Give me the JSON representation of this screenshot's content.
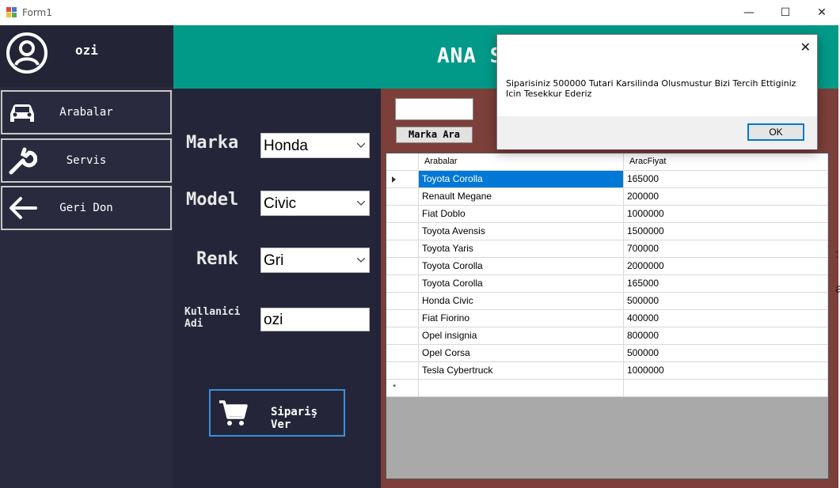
{
  "window": {
    "title": "Form1",
    "minimize": "—",
    "maximize": "☐",
    "close": "✕"
  },
  "sidebar": {
    "username": "ozi",
    "items": [
      {
        "label": "Arabalar",
        "icon": "car-icon"
      },
      {
        "label": "Servis",
        "icon": "wrench-icon"
      },
      {
        "label": "Geri Don",
        "icon": "arrow-left-icon"
      }
    ]
  },
  "header": {
    "title": "ANA S"
  },
  "form": {
    "marka_label": "Marka",
    "marka_value": "Honda",
    "model_label": "Model",
    "model_value": "Civic",
    "renk_label": "Renk",
    "renk_value": "Gri",
    "kullanici_label_1": "Kullanici",
    "kullanici_label_2": "Adi",
    "kullanici_value": "ozi",
    "order_button": "Sipariş Ver"
  },
  "search": {
    "value": "",
    "button": "Marka Ara"
  },
  "grid": {
    "columns": [
      "Arabalar",
      "AracFiyat"
    ],
    "rows": [
      [
        "Toyota Corolla",
        "165000"
      ],
      [
        "Renault Megane",
        "200000"
      ],
      [
        "Fiat Doblo",
        "1000000"
      ],
      [
        "Toyota Avensis",
        "1500000"
      ],
      [
        "Toyota Yaris",
        "700000"
      ],
      [
        "Toyota Corolla",
        "2000000"
      ],
      [
        "Toyota Corolla",
        "165000"
      ],
      [
        "Honda Civic",
        "500000"
      ],
      [
        "Fiat Fiorino",
        "400000"
      ],
      [
        "Opel insignia",
        "800000"
      ],
      [
        "Opel Corsa",
        "500000"
      ],
      [
        "Tesla Cybertruck",
        "1000000"
      ]
    ],
    "selected_row": 0,
    "new_row_marker": "*"
  },
  "peek_chars": [
    ":",
    "a"
  ],
  "message": {
    "text": "Siparisiniz 500000 Tutari Karsilinda Olusmustur Bizi Tercih Ettiginiz Icin Tesekkur Ederiz",
    "ok": "OK",
    "close": "✕"
  },
  "colors": {
    "header": "#019a88",
    "sidebar": "#2a2a3e",
    "right_panel": "#7d3f3a",
    "selection": "#0078d7"
  }
}
